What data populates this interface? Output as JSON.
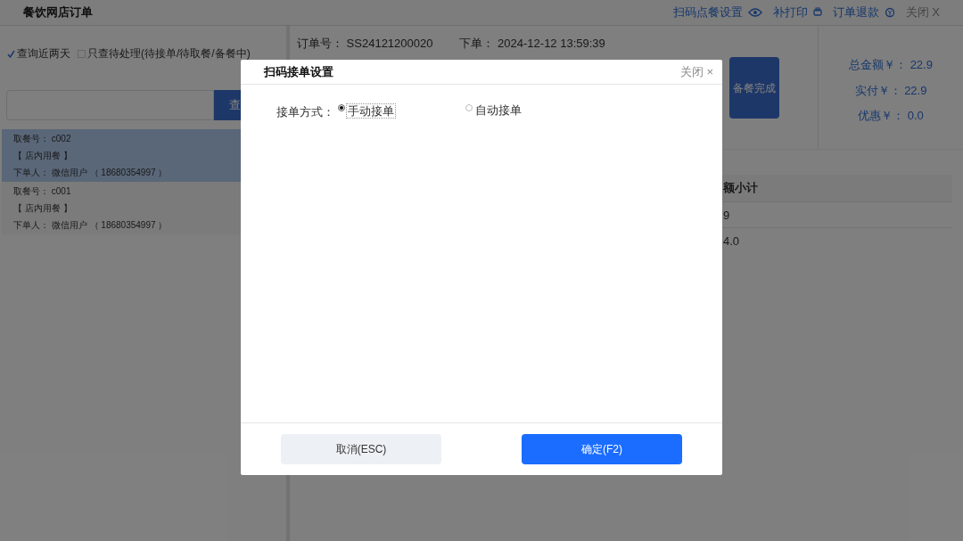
{
  "window": {
    "title": "餐饮网店订单",
    "actions": [
      {
        "label": "扫码点餐设置"
      },
      {
        "label": "补打印"
      },
      {
        "label": "订单退款"
      }
    ],
    "close": "关闭 X"
  },
  "filters": [
    {
      "label": "查询近两天",
      "checked": true
    },
    {
      "label": "只查待处理(待接单/待取餐/备餐中)",
      "checked": false
    }
  ],
  "search": {
    "button": "查"
  },
  "orders": [
    {
      "pickup_label": "取餐号：",
      "pickup": "c002",
      "type": "【 店内用餐 】",
      "buyer_label": "下单人：",
      "buyer": "微信用户 （ 18680354997 ）",
      "selected": true
    },
    {
      "pickup_label": "取餐号：",
      "pickup": "c001",
      "type": "【 店内用餐 】",
      "buyer_label": "下单人：",
      "buyer": "微信用户 （ 18680354997 ）",
      "selected": false
    }
  ],
  "detail": {
    "order_label": "订单号：",
    "order_no": "SS24121200020",
    "time_label": "下单：",
    "time": "2024-12-12 13:59:39",
    "done_button": "备餐完成"
  },
  "totals": [
    {
      "label": "总金额￥：",
      "value": "22.9"
    },
    {
      "label": "实付￥：",
      "value": "22.9"
    },
    {
      "label": "优惠￥：",
      "value": "0.0"
    }
  ],
  "table": {
    "column": "额小计",
    "rows": [
      "9",
      "4.0"
    ]
  },
  "dialog": {
    "title": "扫码接单设置",
    "close": "关闭 ×",
    "field_label": "接单方式：",
    "options": [
      {
        "label": "手动接单",
        "selected": true
      },
      {
        "label": "自动接单",
        "selected": false
      }
    ],
    "cancel": "取消(ESC)",
    "ok": "确定(F2)"
  }
}
